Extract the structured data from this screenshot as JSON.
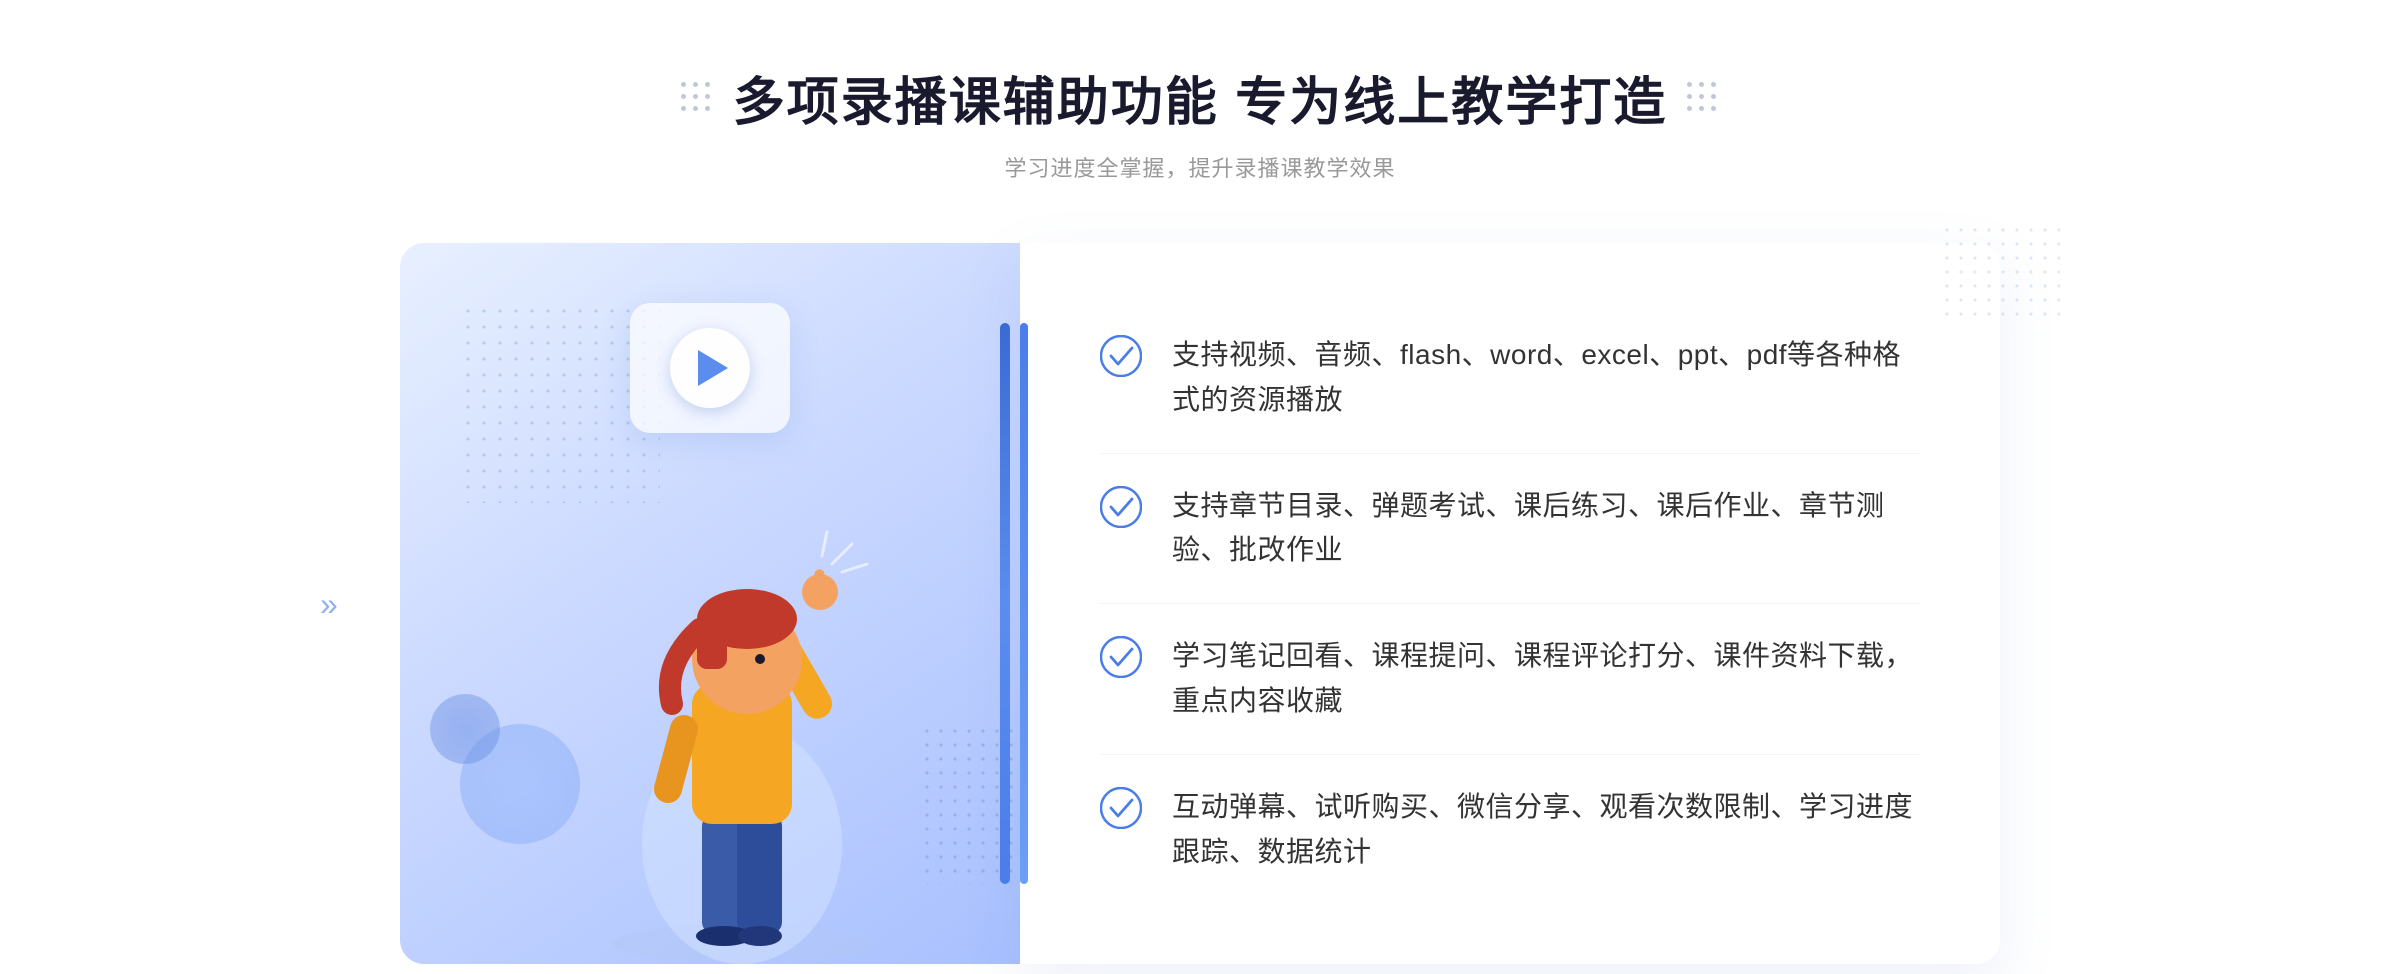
{
  "header": {
    "main_title": "多项录播课辅助功能 专为线上教学打造",
    "subtitle": "学习进度全掌握，提升录播课教学效果"
  },
  "features": [
    {
      "id": 1,
      "text": "支持视频、音频、flash、word、excel、ppt、pdf等各种格式的资源播放"
    },
    {
      "id": 2,
      "text": "支持章节目录、弹题考试、课后练习、课后作业、章节测验、批改作业"
    },
    {
      "id": 3,
      "text": "学习笔记回看、课程提问、课程评论打分、课件资料下载，重点内容收藏"
    },
    {
      "id": 4,
      "text": "互动弹幕、试听购买、微信分享、观看次数限制、学习进度跟踪、数据统计"
    }
  ],
  "icons": {
    "check_color": "#4a7de8",
    "dot_color": "#c0c8d8",
    "arrow_color": "#4a7de8"
  }
}
